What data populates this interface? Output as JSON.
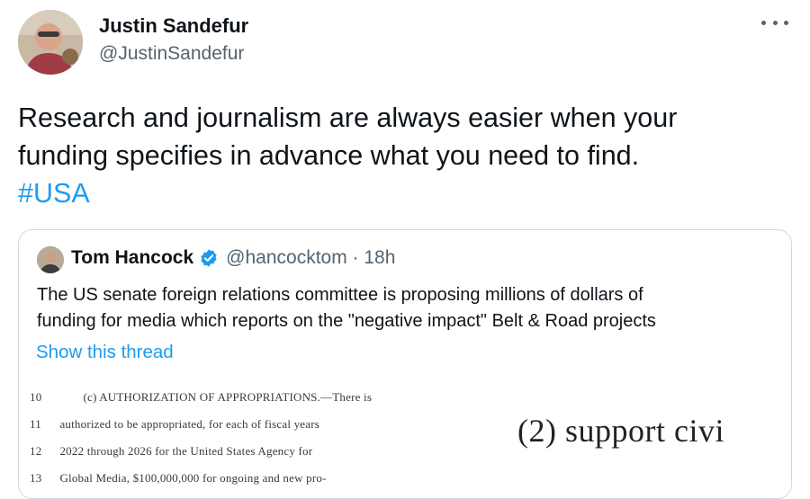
{
  "tweet": {
    "author_name": "Justin Sandefur",
    "author_handle": "@JustinSandefur",
    "text_lines": [
      "Research and journalism are always easier when your",
      "funding specifies in advance what you need to find."
    ],
    "hashtag": "#USA"
  },
  "quote": {
    "name": "Tom Hancock",
    "handle_time": "@hancocktom · 18h",
    "text_lines": [
      "The US senate foreign relations committee is proposing millions of dollars of",
      "funding for media which reports on the \"negative impact\" Belt & Road projects"
    ],
    "show_thread": "Show this thread",
    "doc_left_lines": [
      {
        "num": "10",
        "text": "(c) AUTHORIZATION OF APPROPRIATIONS.—There is"
      },
      {
        "num": "11",
        "text": "authorized to be appropriated, for each of fiscal years"
      },
      {
        "num": "12",
        "text": "2022 through 2026 for the United States Agency for"
      },
      {
        "num": "13",
        "text": "Global Media, $100,000,000 for ongoing and new pro-"
      }
    ],
    "doc_right_text": "(2) support civi"
  },
  "colors": {
    "link": "#1d9bf0",
    "secondary_text": "#536471",
    "border": "#cfd9de"
  },
  "icons": [
    "more-icon",
    "verified-badge-icon"
  ]
}
